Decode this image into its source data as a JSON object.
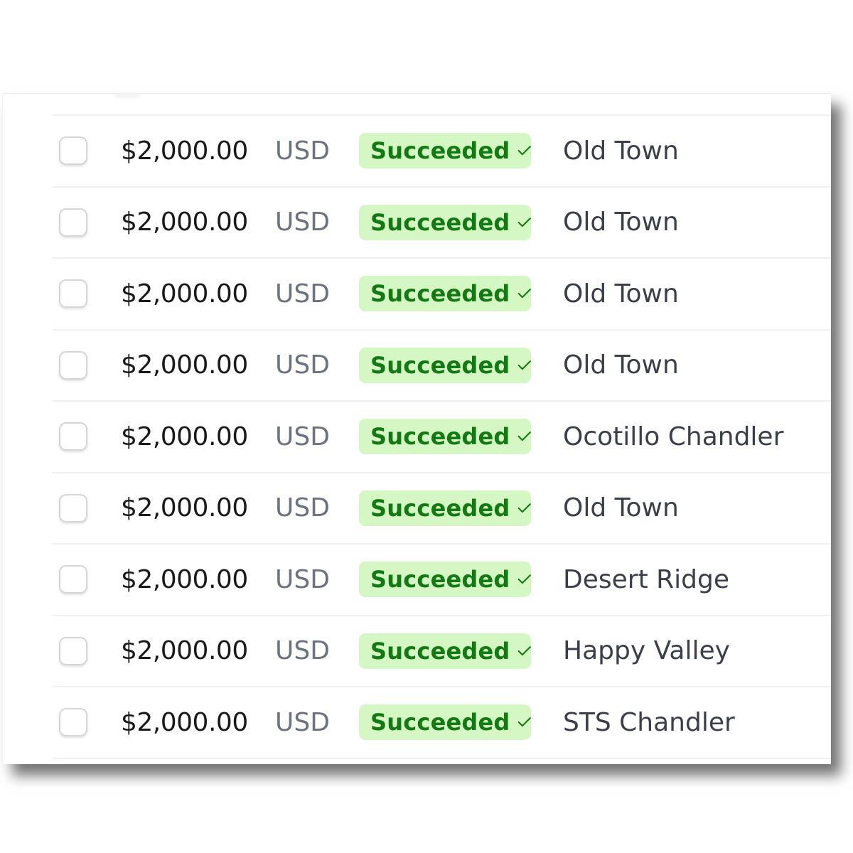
{
  "colors": {
    "badge_background": "#d4f7c4",
    "badge_text": "#137a13",
    "amount_text": "#1a1a1a",
    "currency_text": "#6b7280",
    "location_text": "#3a3f4a"
  },
  "table": {
    "rows": [
      {
        "amount": "$2,000.00",
        "currency": "USD",
        "status": "Succeeded",
        "status_icon": "check-icon",
        "location": "Old Town",
        "selected": false
      },
      {
        "amount": "$2,000.00",
        "currency": "USD",
        "status": "Succeeded",
        "status_icon": "check-icon",
        "location": "Old Town",
        "selected": false
      },
      {
        "amount": "$2,000.00",
        "currency": "USD",
        "status": "Succeeded",
        "status_icon": "check-icon",
        "location": "Old Town",
        "selected": false
      },
      {
        "amount": "$2,000.00",
        "currency": "USD",
        "status": "Succeeded",
        "status_icon": "check-icon",
        "location": "Old Town",
        "selected": false
      },
      {
        "amount": "$2,000.00",
        "currency": "USD",
        "status": "Succeeded",
        "status_icon": "check-icon",
        "location": "Ocotillo Chandler",
        "selected": false
      },
      {
        "amount": "$2,000.00",
        "currency": "USD",
        "status": "Succeeded",
        "status_icon": "check-icon",
        "location": "Old Town",
        "selected": false
      },
      {
        "amount": "$2,000.00",
        "currency": "USD",
        "status": "Succeeded",
        "status_icon": "check-icon",
        "location": "Desert Ridge",
        "selected": false
      },
      {
        "amount": "$2,000.00",
        "currency": "USD",
        "status": "Succeeded",
        "status_icon": "check-icon",
        "location": "Happy Valley",
        "selected": false
      },
      {
        "amount": "$2,000.00",
        "currency": "USD",
        "status": "Succeeded",
        "status_icon": "check-icon",
        "location": "STS Chandler",
        "selected": false
      }
    ]
  }
}
